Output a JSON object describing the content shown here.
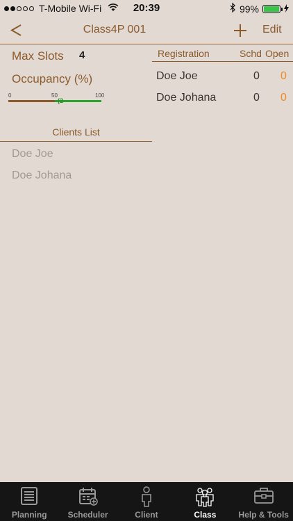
{
  "status_bar": {
    "carrier": "T-Mobile Wi-Fi",
    "time": "20:39",
    "battery_percent": "99%",
    "signal_dots_filled": 2,
    "signal_dots_total": 5
  },
  "navbar": {
    "back_label": "<",
    "title": "Class4P 001",
    "add_label": "+",
    "edit_label": "Edit"
  },
  "class_info": {
    "max_slots_label": "Max  Slots",
    "max_slots_value": "4",
    "occupancy_label": "Occupancy (%)",
    "gauge": {
      "tick_min": "0",
      "tick_mid": "50",
      "tick_max": "100",
      "value_percent": 50,
      "marker_label": "(2"
    }
  },
  "clients": {
    "header": "Clients List",
    "items": [
      "Doe Joe",
      "Doe Johana"
    ]
  },
  "registration": {
    "headers": {
      "name": "Registration",
      "schd": "Schd",
      "open": "Open"
    },
    "rows": [
      {
        "name": "Doe Joe",
        "schd": "0",
        "open": "0"
      },
      {
        "name": "Doe Johana",
        "schd": "0",
        "open": "0"
      }
    ]
  },
  "tabbar": {
    "tabs": [
      {
        "label": "Planning",
        "icon": "planning-icon",
        "active": false
      },
      {
        "label": "Scheduler",
        "icon": "scheduler-icon",
        "active": false
      },
      {
        "label": "Client",
        "icon": "client-icon",
        "active": false
      },
      {
        "label": "Class",
        "icon": "class-icon",
        "active": true
      },
      {
        "label": "Help & Tools",
        "icon": "toolbox-icon",
        "active": false
      }
    ]
  },
  "colors": {
    "background": "#e2d9d2",
    "accent_brown": "#8b5a2b",
    "open_orange": "#f08a24",
    "gauge_green": "#2ea22e",
    "tabbar_bg": "#151515"
  }
}
